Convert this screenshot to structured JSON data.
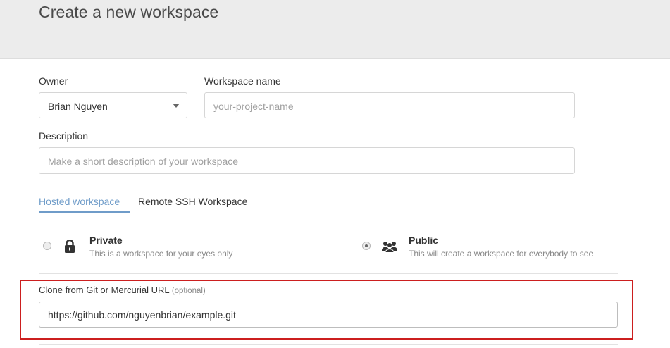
{
  "header": {
    "title": "Create a new workspace"
  },
  "form": {
    "owner": {
      "label": "Owner",
      "value": "Brian Nguyen"
    },
    "workspace_name": {
      "label": "Workspace name",
      "placeholder": "your-project-name"
    },
    "description": {
      "label": "Description",
      "placeholder": "Make a short description of your workspace"
    }
  },
  "tabs": [
    {
      "label": "Hosted workspace",
      "active": true
    },
    {
      "label": "Remote SSH Workspace",
      "active": false
    }
  ],
  "visibility": {
    "private": {
      "title": "Private",
      "desc": "This is a workspace for your eyes only",
      "icon": "lock-icon",
      "selected": false
    },
    "public": {
      "title": "Public",
      "desc": "This will create a workspace for everybody to see",
      "icon": "users-icon",
      "selected": true
    }
  },
  "clone": {
    "label": "Clone from Git or Mercurial URL",
    "optional": "(optional)",
    "value": "https://github.com/nguyenbrian/example.git"
  },
  "colors": {
    "accent": "#6f9cc9",
    "highlight": "#cc1f1f"
  }
}
